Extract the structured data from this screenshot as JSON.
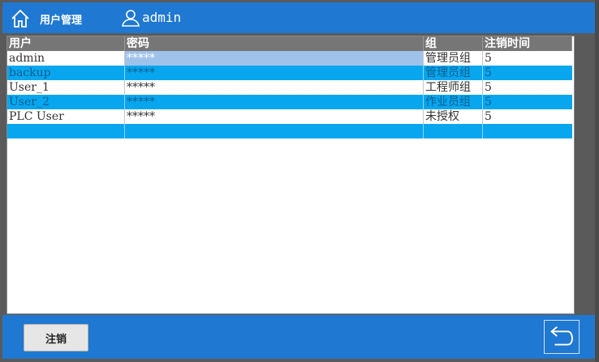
{
  "header": {
    "title": "用户管理",
    "current_user": "admin"
  },
  "table": {
    "columns": [
      "用户",
      "密码",
      "组",
      "注销时间"
    ],
    "rows": [
      {
        "user": "admin",
        "password": "*****",
        "group": "管理员组",
        "logout_time": "5"
      },
      {
        "user": "backup",
        "password": "*****",
        "group": "管理员组",
        "logout_time": "5"
      },
      {
        "user": "User_1",
        "password": "*****",
        "group": "工程师组",
        "logout_time": "5"
      },
      {
        "user": "User_2",
        "password": "*****",
        "group": "作业员组",
        "logout_time": "5"
      },
      {
        "user": "PLC User",
        "password": "*****",
        "group": "未授权",
        "logout_time": "5"
      },
      {
        "user": "",
        "password": "",
        "group": "",
        "logout_time": ""
      }
    ]
  },
  "footer": {
    "logout_label": "注销"
  },
  "colors": {
    "header_bg": "#1f78d1",
    "row_alt": "#08a6ef",
    "selection": "#9fc2ea",
    "column_header": "#767676"
  }
}
